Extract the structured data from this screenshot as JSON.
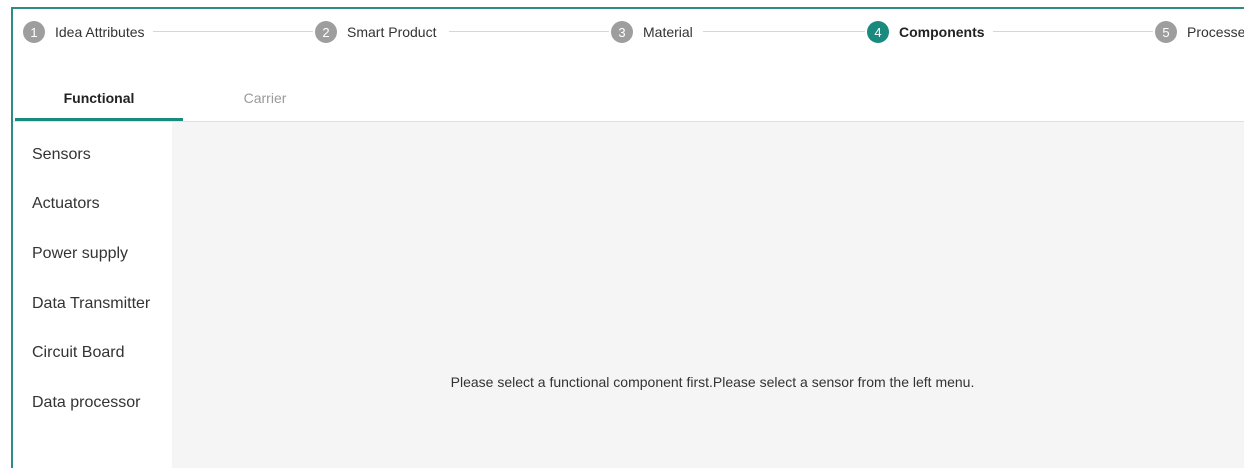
{
  "stepper": {
    "steps": [
      {
        "number": "1",
        "label": "Idea Attributes",
        "active": false
      },
      {
        "number": "2",
        "label": "Smart Product",
        "active": false
      },
      {
        "number": "3",
        "label": "Material",
        "active": false
      },
      {
        "number": "4",
        "label": "Components",
        "active": true
      },
      {
        "number": "5",
        "label": "Processes",
        "active": false
      }
    ]
  },
  "tabs": [
    {
      "label": "Functional",
      "active": true
    },
    {
      "label": "Carrier",
      "active": false
    }
  ],
  "sidebar": {
    "items": [
      {
        "label": "Sensors"
      },
      {
        "label": "Actuators"
      },
      {
        "label": "Power supply"
      },
      {
        "label": "Data Transmitter"
      },
      {
        "label": "Circuit Board"
      },
      {
        "label": "Data processor"
      }
    ]
  },
  "panel": {
    "message": "Please select a functional component first.Please select a sensor from the left menu."
  },
  "colors": {
    "accent": "#1b8a7e",
    "border": "#2e8b86",
    "inactive_step": "#9e9e9e",
    "panel_bg": "#f5f5f5"
  }
}
